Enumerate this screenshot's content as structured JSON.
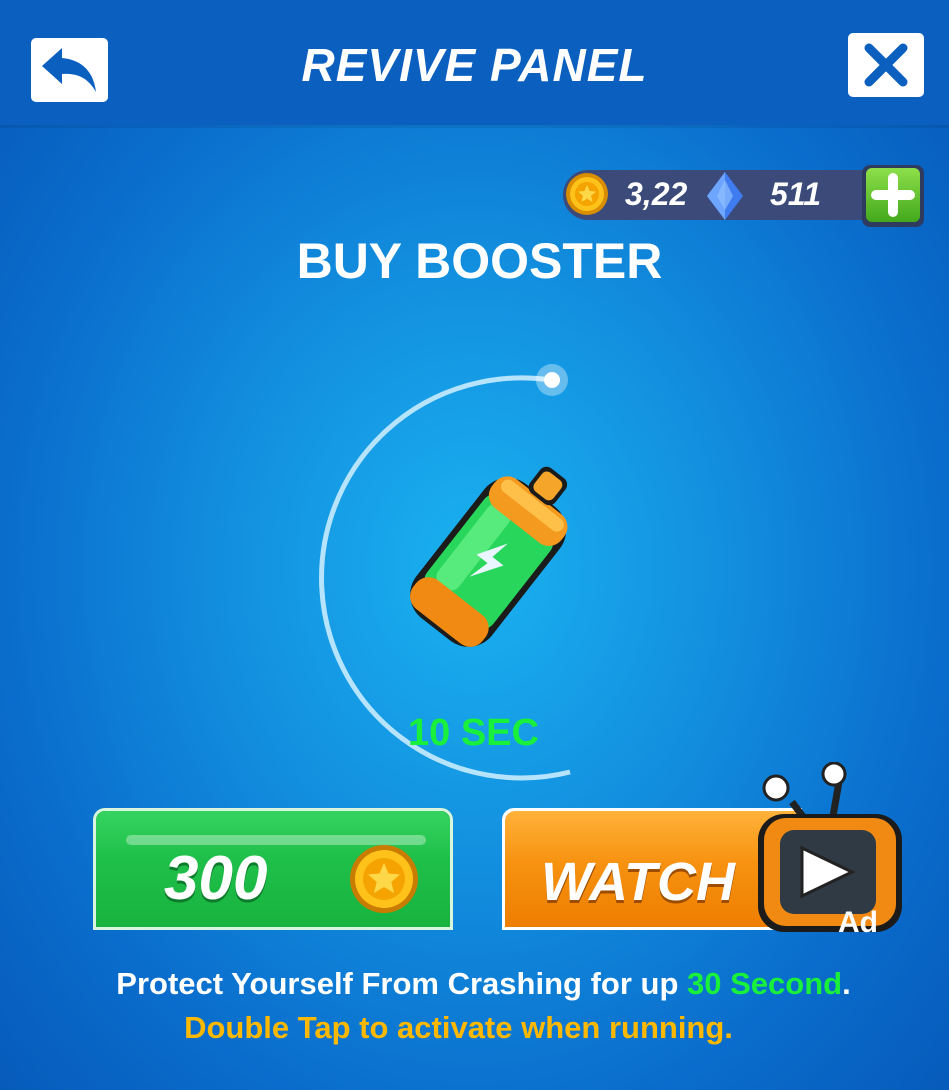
{
  "header": {
    "title": "REVIVE PANEL",
    "back_icon": "back-arrow-icon",
    "close_icon": "close-icon"
  },
  "currency": {
    "coins": "3,22",
    "gems": "511",
    "add_icon": "plus-icon"
  },
  "main": {
    "heading": "BUY BOOSTER",
    "item_icon": "battery-booster-icon",
    "timer": "10 SEC"
  },
  "buttons": {
    "buy_price": "300",
    "watch_label": "WATCH",
    "ad_label": "Ad"
  },
  "description": {
    "line1_prefix": "Protect Yourself From Crashing for up ",
    "line1_highlight": "30 Second",
    "line1_suffix": ".",
    "line2": "Double Tap to activate when running."
  },
  "colors": {
    "header_bg": "#0a5fbf",
    "highlight_green": "#19f03c",
    "hint_orange": "#ffb800",
    "buy_green": "#1fc04a",
    "watch_orange": "#f79210"
  }
}
